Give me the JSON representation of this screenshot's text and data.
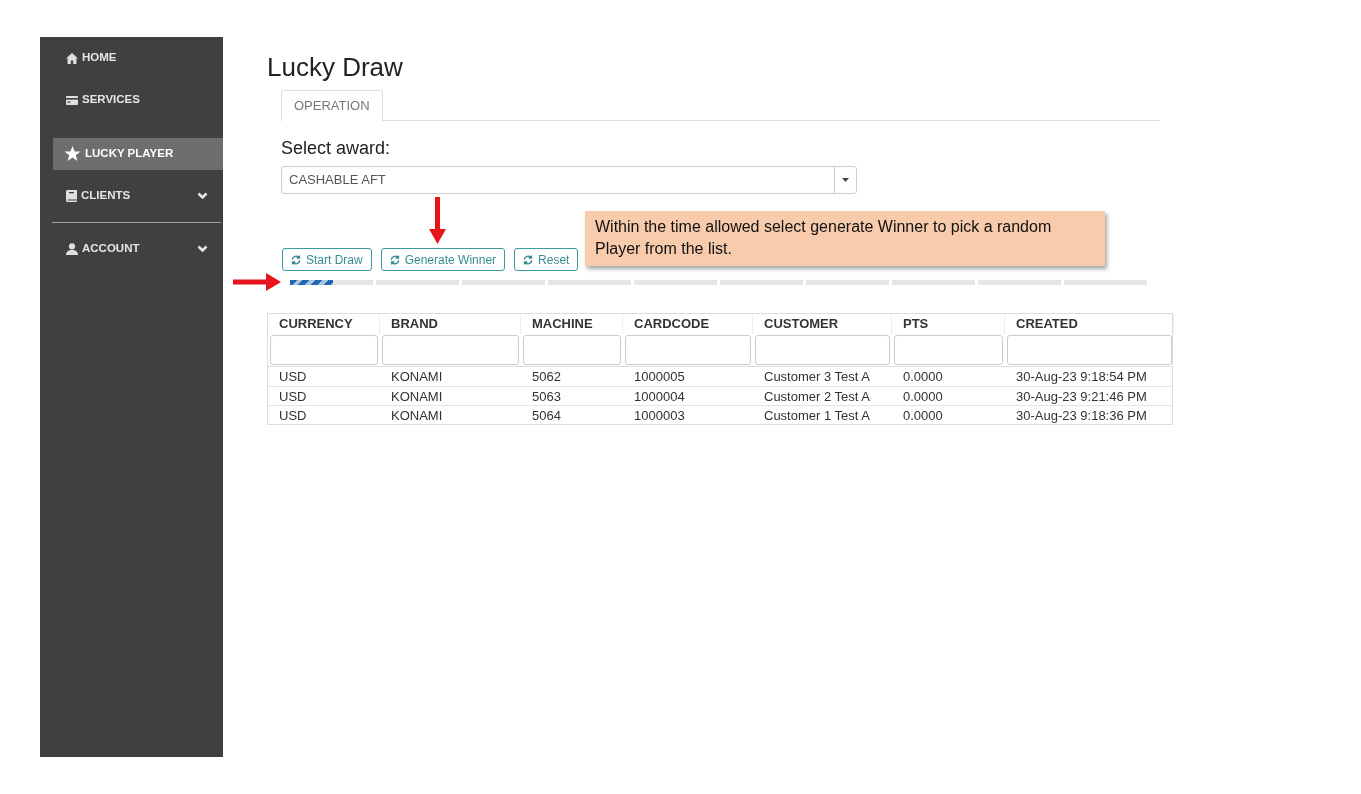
{
  "sidebar": {
    "items": [
      {
        "label": "HOME",
        "kind": "link",
        "selected": false,
        "divider_above": false
      },
      {
        "label": "SERVICES",
        "kind": "link",
        "selected": false,
        "divider_above": false
      },
      {
        "label": "LUCKY PLAYER",
        "kind": "link",
        "selected": true,
        "divider_above": false
      },
      {
        "label": "CLIENTS",
        "kind": "group",
        "selected": false,
        "expanded": false,
        "divider_above": false
      },
      {
        "label": "ACCOUNT",
        "kind": "group",
        "selected": false,
        "expanded": false,
        "divider_above": true
      }
    ]
  },
  "page": {
    "title": "Lucky Draw"
  },
  "tabs": [
    {
      "label": "OPERATION",
      "selected": true
    }
  ],
  "award": {
    "label": "Select award:",
    "value": "CASHABLE AFT"
  },
  "buttons": [
    {
      "label": "Start Draw"
    },
    {
      "label": "Generate Winner"
    },
    {
      "label": "Reset"
    }
  ],
  "progress": {
    "level": 0.05
  },
  "table": {
    "columns": [
      "CURRENCY",
      "BRAND",
      "MACHINE",
      "CARDCODE",
      "CUSTOMER",
      "PTS",
      "CREATED"
    ],
    "rows": [
      [
        "USD",
        "KONAMI",
        "5062",
        "1000005",
        "Customer 3 Test A",
        "0.0000",
        "30-Aug-23 9:18:54 PM"
      ],
      [
        "USD",
        "KONAMI",
        "5063",
        "1000004",
        "Customer 2 Test A",
        "0.0000",
        "30-Aug-23 9:21:46 PM"
      ],
      [
        "USD",
        "KONAMI",
        "5064",
        "1000003",
        "Customer 1 Test A",
        "0.0000",
        "30-Aug-23 9:18:36 PM"
      ]
    ]
  },
  "annotation": {
    "text": "Within the time allowed select generate Winner to pick a random Player from the list."
  }
}
